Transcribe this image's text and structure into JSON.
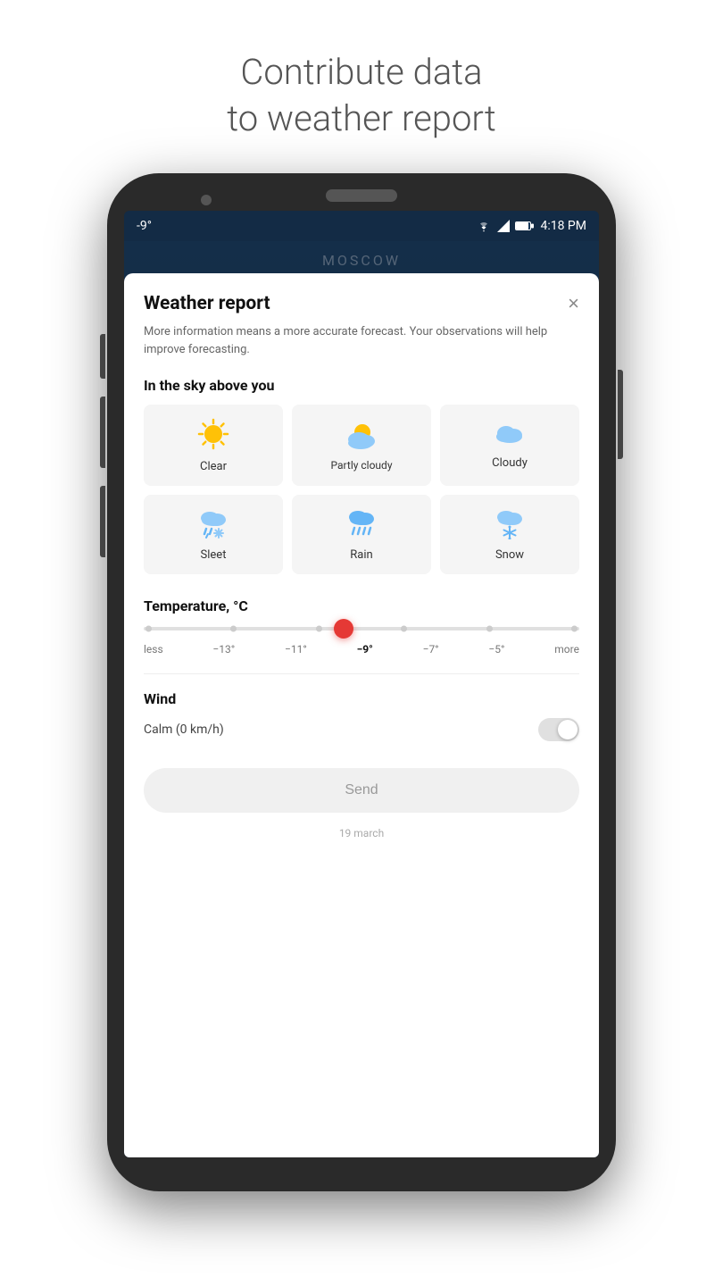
{
  "page": {
    "header_line1": "Contribute data",
    "header_line2": "to weather report"
  },
  "status_bar": {
    "temp": "-9°",
    "time": "4:18 PM"
  },
  "app": {
    "city": "Moscow"
  },
  "modal": {
    "title": "Weather report",
    "subtitle": "More information means a more accurate forecast. Your observations will help improve forecasting.",
    "sky_section_title": "In the sky above you",
    "weather_options": [
      {
        "id": "clear",
        "label": "Clear",
        "icon": "sun"
      },
      {
        "id": "partly-cloudy",
        "label": "Partly cloudy",
        "icon": "partly-cloudy"
      },
      {
        "id": "cloudy",
        "label": "Cloudy",
        "icon": "cloudy"
      },
      {
        "id": "sleet",
        "label": "Sleet",
        "icon": "sleet"
      },
      {
        "id": "rain",
        "label": "Rain",
        "icon": "rain"
      },
      {
        "id": "snow",
        "label": "Snow",
        "icon": "snow"
      }
    ],
    "temp_section_title": "Temperature, °C",
    "temp_labels": [
      "less",
      "−13°",
      "−11°",
      "−9°",
      "−7°",
      "−5°",
      "more"
    ],
    "temp_current": "−9°",
    "wind_section_title": "Wind",
    "wind_label": "Calm (0 km/h)",
    "send_button": "Send"
  },
  "date_bar": "19 march"
}
